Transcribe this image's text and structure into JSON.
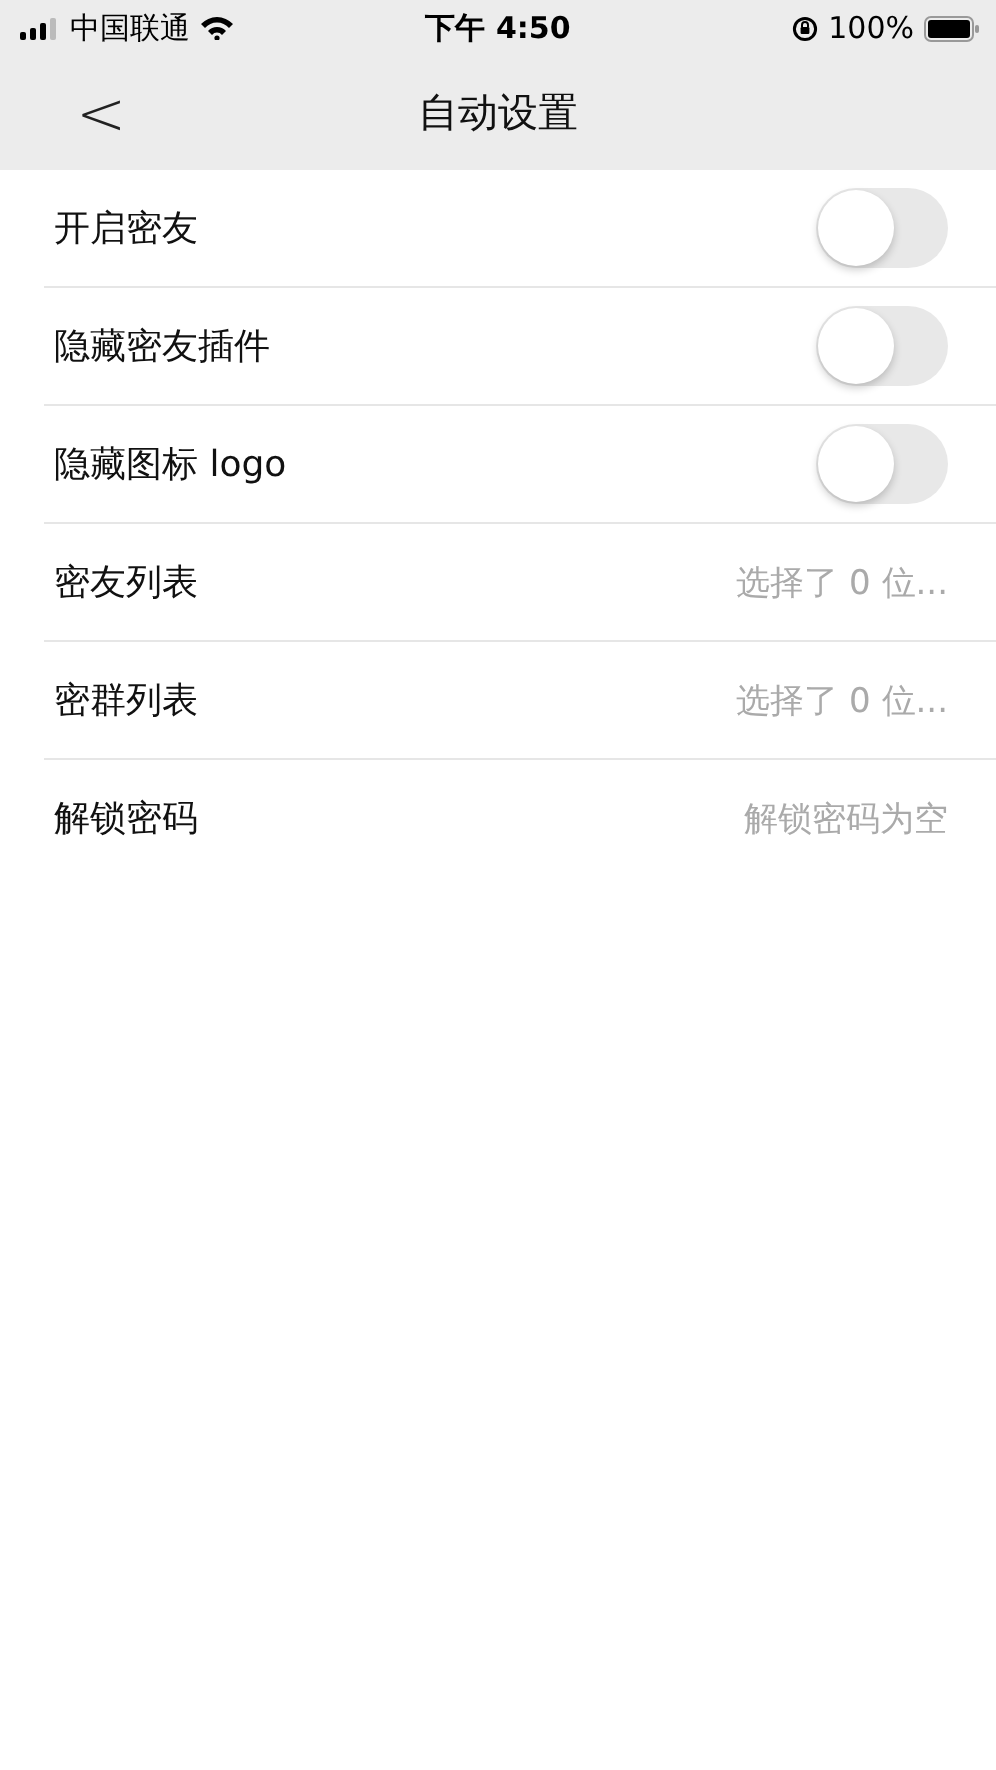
{
  "status_bar": {
    "carrier": "中国联通",
    "time": "下午 4:50",
    "battery": "100%"
  },
  "nav": {
    "back": "<",
    "title": "自动设置"
  },
  "rows": [
    {
      "kind": "toggle",
      "label": "开启密友",
      "on": false
    },
    {
      "kind": "toggle",
      "label": "隐藏密友插件",
      "on": false
    },
    {
      "kind": "toggle",
      "label": "隐藏图标 logo",
      "on": false
    },
    {
      "kind": "value",
      "label": "密友列表",
      "value": "选择了 0 位..."
    },
    {
      "kind": "value",
      "label": "密群列表",
      "value": "选择了 0 位..."
    },
    {
      "kind": "value",
      "label": "解锁密码",
      "value": "解锁密码为空"
    }
  ]
}
